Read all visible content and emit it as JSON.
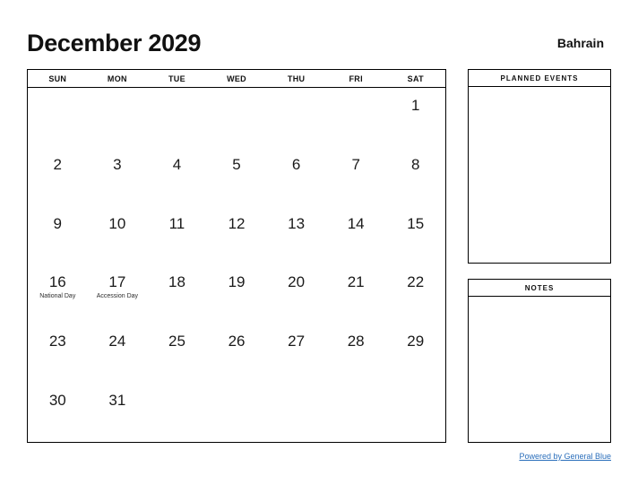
{
  "header": {
    "month_title": "December 2029",
    "country": "Bahrain"
  },
  "calendar": {
    "weekdays": [
      "SUN",
      "MON",
      "TUE",
      "WED",
      "THU",
      "FRI",
      "SAT"
    ],
    "weeks": [
      [
        {
          "day": "",
          "event": ""
        },
        {
          "day": "",
          "event": ""
        },
        {
          "day": "",
          "event": ""
        },
        {
          "day": "",
          "event": ""
        },
        {
          "day": "",
          "event": ""
        },
        {
          "day": "",
          "event": ""
        },
        {
          "day": "1",
          "event": ""
        }
      ],
      [
        {
          "day": "2",
          "event": ""
        },
        {
          "day": "3",
          "event": ""
        },
        {
          "day": "4",
          "event": ""
        },
        {
          "day": "5",
          "event": ""
        },
        {
          "day": "6",
          "event": ""
        },
        {
          "day": "7",
          "event": ""
        },
        {
          "day": "8",
          "event": ""
        }
      ],
      [
        {
          "day": "9",
          "event": ""
        },
        {
          "day": "10",
          "event": ""
        },
        {
          "day": "11",
          "event": ""
        },
        {
          "day": "12",
          "event": ""
        },
        {
          "day": "13",
          "event": ""
        },
        {
          "day": "14",
          "event": ""
        },
        {
          "day": "15",
          "event": ""
        }
      ],
      [
        {
          "day": "16",
          "event": "National Day"
        },
        {
          "day": "17",
          "event": "Accession Day"
        },
        {
          "day": "18",
          "event": ""
        },
        {
          "day": "19",
          "event": ""
        },
        {
          "day": "20",
          "event": ""
        },
        {
          "day": "21",
          "event": ""
        },
        {
          "day": "22",
          "event": ""
        }
      ],
      [
        {
          "day": "23",
          "event": ""
        },
        {
          "day": "24",
          "event": ""
        },
        {
          "day": "25",
          "event": ""
        },
        {
          "day": "26",
          "event": ""
        },
        {
          "day": "27",
          "event": ""
        },
        {
          "day": "28",
          "event": ""
        },
        {
          "day": "29",
          "event": ""
        }
      ],
      [
        {
          "day": "30",
          "event": ""
        },
        {
          "day": "31",
          "event": ""
        },
        {
          "day": "",
          "event": ""
        },
        {
          "day": "",
          "event": ""
        },
        {
          "day": "",
          "event": ""
        },
        {
          "day": "",
          "event": ""
        },
        {
          "day": "",
          "event": ""
        }
      ]
    ]
  },
  "panels": {
    "planned_events_title": "PLANNED EVENTS",
    "notes_title": "NOTES"
  },
  "footer": {
    "link_text": "Powered by General Blue",
    "link_color": "#2a6ebb"
  }
}
